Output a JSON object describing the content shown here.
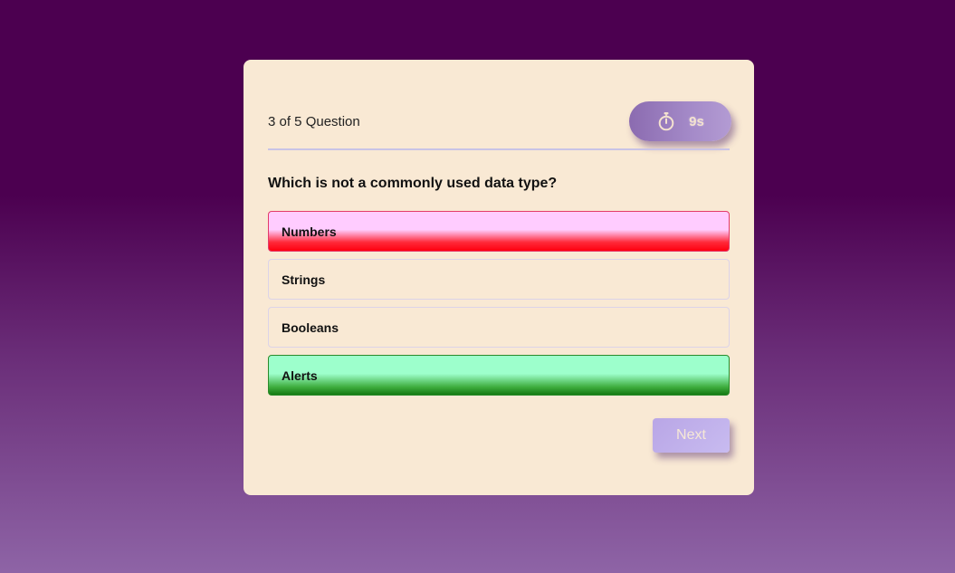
{
  "quiz": {
    "counter": "3 of 5 Question",
    "timer": {
      "icon": "stopwatch-icon",
      "value": "9s"
    },
    "question": "Which is not a commonly used data type?",
    "options": [
      {
        "label": "Numbers",
        "state": "wrong"
      },
      {
        "label": "Strings",
        "state": "neutral"
      },
      {
        "label": "Booleans",
        "state": "neutral"
      },
      {
        "label": "Alerts",
        "state": "correct"
      }
    ],
    "next_label": "Next"
  },
  "colors": {
    "background_top": "#4c0050",
    "background_bottom": "#8e64a6",
    "card": "#f9e9d4",
    "wrong": "#ff1a2e",
    "correct": "#1f8a1a",
    "accent": "#a48ac8"
  }
}
